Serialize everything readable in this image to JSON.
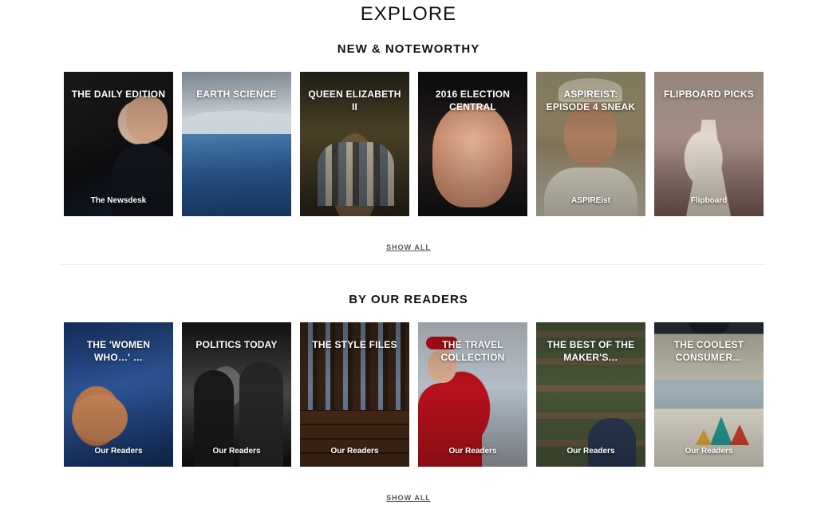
{
  "page": {
    "title": "EXPLORE"
  },
  "sections": [
    {
      "title": "NEW & NOTEWORTHY",
      "show_all": "SHOW ALL",
      "tiles": [
        {
          "title": "THE DAILY EDITION",
          "author": "The Newsdesk"
        },
        {
          "title": "EARTH SCIENCE",
          "author": ""
        },
        {
          "title": "QUEEN ELIZABETH II",
          "author": ""
        },
        {
          "title": "2016 ELECTION CENTRAL",
          "author": ""
        },
        {
          "title": "ASPIREIST: EPISODE 4 SNEAK",
          "author": "ASPIREist"
        },
        {
          "title": "FLIPBOARD PICKS",
          "author": "Flipboard"
        }
      ]
    },
    {
      "title": "BY OUR READERS",
      "show_all": "SHOW ALL",
      "tiles": [
        {
          "title": "THE 'WOMEN WHO…' …",
          "author": "Our Readers"
        },
        {
          "title": "POLITICS TODAY",
          "author": "Our Readers"
        },
        {
          "title": "THE STYLE FILES",
          "author": "Our Readers"
        },
        {
          "title": "THE TRAVEL COLLECTION",
          "author": "Our Readers"
        },
        {
          "title": "THE BEST OF THE MAKER'S…",
          "author": "Our Readers"
        },
        {
          "title": "THE COOLEST CONSUMER…",
          "author": "Our Readers"
        }
      ]
    }
  ]
}
